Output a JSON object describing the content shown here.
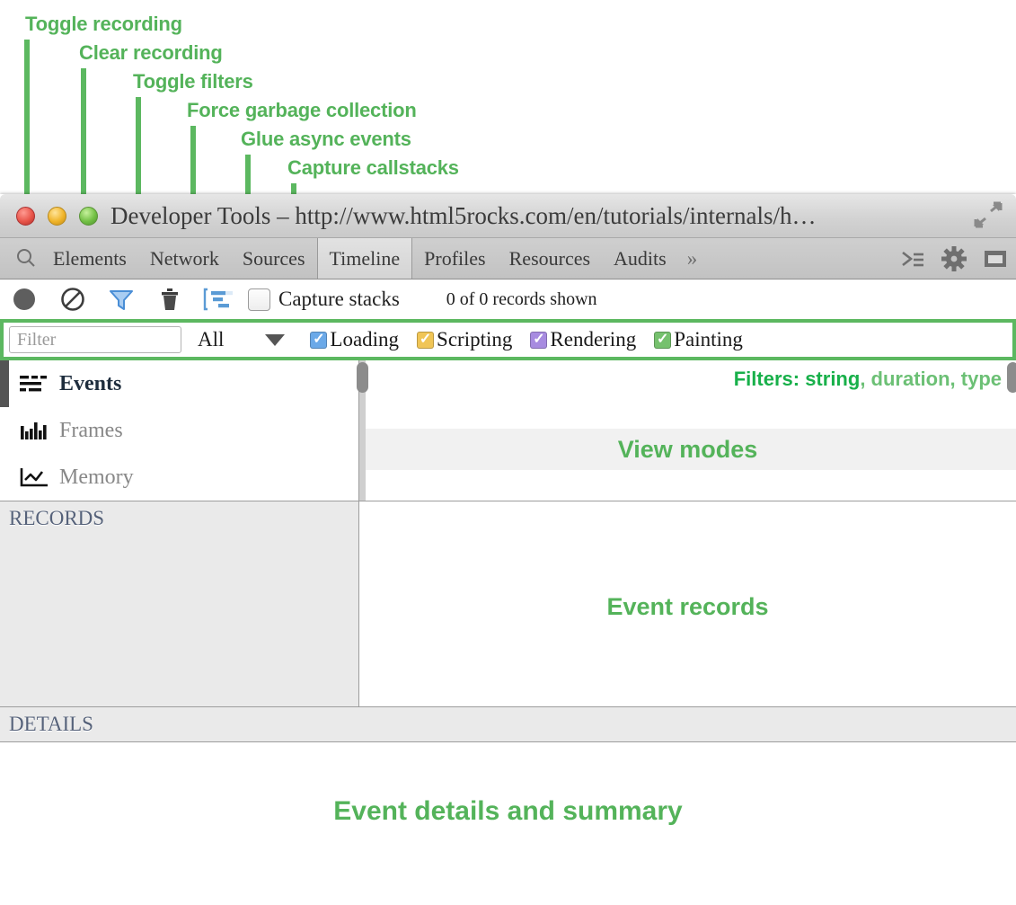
{
  "annotations": {
    "color_primary": "#54b35a",
    "color_bright": "#22b14c",
    "callouts": [
      {
        "label": "Toggle recording"
      },
      {
        "label": "Clear recording"
      },
      {
        "label": "Toggle filters"
      },
      {
        "label": "Force garbage collection"
      },
      {
        "label": "Glue async events"
      },
      {
        "label": "Capture callstacks"
      }
    ],
    "filters_note_prefix": "Filters: string",
    "filters_note_suffix": ", duration, type",
    "view_modes_note": "View modes",
    "event_records_note": "Event records",
    "event_details_note": "Event details and summary"
  },
  "window": {
    "title": "Developer Tools – http://www.html5rocks.com/en/tutorials/internals/h…",
    "traffic_lights": [
      "close-button",
      "minimize-button",
      "zoom-button"
    ],
    "expand_icon": "expand-arrows-icon"
  },
  "tabs": {
    "search_icon": "search-icon",
    "items": [
      {
        "label": "Elements",
        "active": false
      },
      {
        "label": "Network",
        "active": false
      },
      {
        "label": "Sources",
        "active": false
      },
      {
        "label": "Timeline",
        "active": true
      },
      {
        "label": "Profiles",
        "active": false
      },
      {
        "label": "Resources",
        "active": false
      },
      {
        "label": "Audits",
        "active": false
      }
    ],
    "overflow": "»",
    "right_icons": [
      "console-drawer-icon",
      "gear-icon",
      "dock-window-icon"
    ]
  },
  "toolbar": {
    "buttons": [
      {
        "name": "record-button",
        "icon": "record-circle-icon"
      },
      {
        "name": "clear-button",
        "icon": "no-entry-icon"
      },
      {
        "name": "filter-button",
        "icon": "funnel-icon"
      },
      {
        "name": "garbage-collect-button",
        "icon": "trash-icon"
      },
      {
        "name": "glue-async-events-button",
        "icon": "glue-async-icon"
      }
    ],
    "capture_stacks_label": "Capture stacks",
    "capture_stacks_checked": false,
    "records_shown": "0 of 0 records shown"
  },
  "filterbar": {
    "filter_placeholder": "Filter",
    "filter_value": "",
    "select_value": "All",
    "categories": [
      {
        "label": "Loading",
        "checked": true,
        "color": "#6ba9e8"
      },
      {
        "label": "Scripting",
        "checked": true,
        "color": "#f0c556"
      },
      {
        "label": "Rendering",
        "checked": true,
        "color": "#a78be0"
      },
      {
        "label": "Painting",
        "checked": true,
        "color": "#76c16e"
      }
    ]
  },
  "view_modes": {
    "items": [
      {
        "label": "Events",
        "icon": "events-lines-icon",
        "active": true
      },
      {
        "label": "Frames",
        "icon": "frames-bars-icon",
        "active": false
      },
      {
        "label": "Memory",
        "icon": "memory-linechart-icon",
        "active": false
      }
    ]
  },
  "panels": {
    "records_title": "RECORDS",
    "details_title": "DETAILS"
  }
}
